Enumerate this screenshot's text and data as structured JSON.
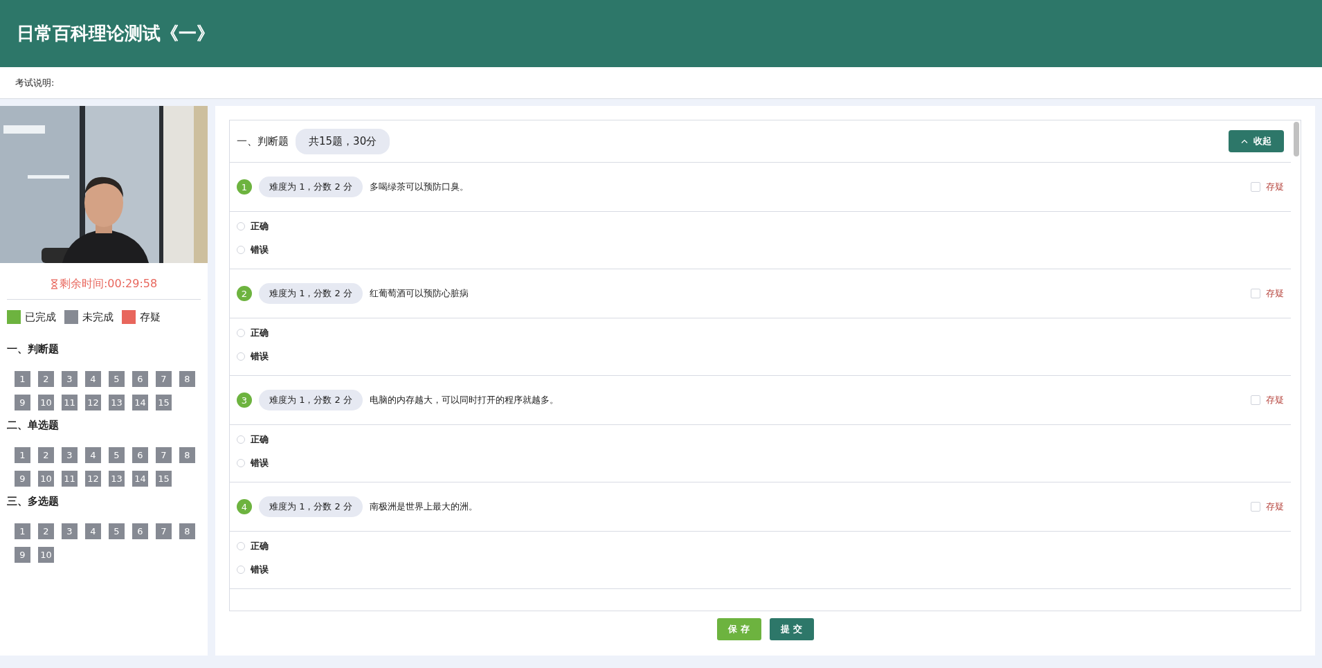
{
  "header": {
    "title": "日常百科理论测试《一》"
  },
  "info_bar": {
    "label": "考试说明:"
  },
  "sidebar": {
    "timer": "剩余时间:00:29:58",
    "legend": [
      {
        "label": "已完成",
        "color": "#6db33f"
      },
      {
        "label": "未完成",
        "color": "#868a93"
      },
      {
        "label": "存疑",
        "color": "#e8665c"
      }
    ],
    "sections": [
      {
        "title": "一、判断题",
        "items": [
          {
            "label": "1",
            "color": "#868a93"
          },
          {
            "label": "2",
            "color": "#868a93"
          },
          {
            "label": "3",
            "color": "#868a93"
          },
          {
            "label": "4",
            "color": "#868a93"
          },
          {
            "label": "5",
            "color": "#868a93"
          },
          {
            "label": "6",
            "color": "#868a93"
          },
          {
            "label": "7",
            "color": "#868a93"
          },
          {
            "label": "8",
            "color": "#868a93"
          },
          {
            "label": "9",
            "color": "#868a93"
          },
          {
            "label": "10",
            "color": "#868a93"
          },
          {
            "label": "11",
            "color": "#868a93"
          },
          {
            "label": "12",
            "color": "#868a93"
          },
          {
            "label": "13",
            "color": "#868a93"
          },
          {
            "label": "14",
            "color": "#868a93"
          },
          {
            "label": "15",
            "color": "#868a93"
          }
        ]
      },
      {
        "title": "二、单选题",
        "items": [
          {
            "label": "1",
            "color": "#868a93"
          },
          {
            "label": "2",
            "color": "#868a93"
          },
          {
            "label": "3",
            "color": "#868a93"
          },
          {
            "label": "4",
            "color": "#868a93"
          },
          {
            "label": "5",
            "color": "#868a93"
          },
          {
            "label": "6",
            "color": "#868a93"
          },
          {
            "label": "7",
            "color": "#868a93"
          },
          {
            "label": "8",
            "color": "#868a93"
          },
          {
            "label": "9",
            "color": "#868a93"
          },
          {
            "label": "10",
            "color": "#868a93"
          },
          {
            "label": "11",
            "color": "#868a93"
          },
          {
            "label": "12",
            "color": "#868a93"
          },
          {
            "label": "13",
            "color": "#868a93"
          },
          {
            "label": "14",
            "color": "#868a93"
          },
          {
            "label": "15",
            "color": "#868a93"
          }
        ]
      },
      {
        "title": "三、多选题",
        "items": [
          {
            "label": "1",
            "color": "#868a93"
          },
          {
            "label": "2",
            "color": "#868a93"
          },
          {
            "label": "3",
            "color": "#868a93"
          },
          {
            "label": "4",
            "color": "#868a93"
          },
          {
            "label": "5",
            "color": "#868a93"
          },
          {
            "label": "6",
            "color": "#868a93"
          },
          {
            "label": "7",
            "color": "#868a93"
          },
          {
            "label": "8",
            "color": "#868a93"
          },
          {
            "label": "9",
            "color": "#868a93"
          },
          {
            "label": "10",
            "color": "#868a93"
          }
        ]
      }
    ]
  },
  "exam": {
    "section_title": "一、判断题",
    "section_summary": "共15题，30分",
    "collapse_button": "收起",
    "questions": [
      {
        "number": "1",
        "meta": "难度为 1，分数 2 分",
        "text": "多喝绿茶可以预防口臭。",
        "doubt_label": "存疑",
        "doubt": false,
        "options": [
          {
            "label": "正确",
            "selected": false
          },
          {
            "label": "错误",
            "selected": false
          }
        ]
      },
      {
        "number": "2",
        "meta": "难度为 1，分数 2 分",
        "text": "红葡萄酒可以预防心脏病",
        "doubt_label": "存疑",
        "doubt": false,
        "options": [
          {
            "label": "正确",
            "selected": false
          },
          {
            "label": "错误",
            "selected": false
          }
        ]
      },
      {
        "number": "3",
        "meta": "难度为 1，分数 2 分",
        "text": "电脑的内存越大，可以同时打开的程序就越多。",
        "doubt_label": "存疑",
        "doubt": false,
        "options": [
          {
            "label": "正确",
            "selected": false
          },
          {
            "label": "错误",
            "selected": false
          }
        ]
      },
      {
        "number": "4",
        "meta": "难度为 1，分数 2 分",
        "text": "南极洲是世界上最大的洲。",
        "doubt_label": "存疑",
        "doubt": false,
        "options": [
          {
            "label": "正确",
            "selected": false
          },
          {
            "label": "错误",
            "selected": false
          }
        ]
      }
    ],
    "buttons": [
      {
        "label": "保 存",
        "kind": "save"
      },
      {
        "label": "提 交",
        "kind": "submit"
      }
    ]
  }
}
